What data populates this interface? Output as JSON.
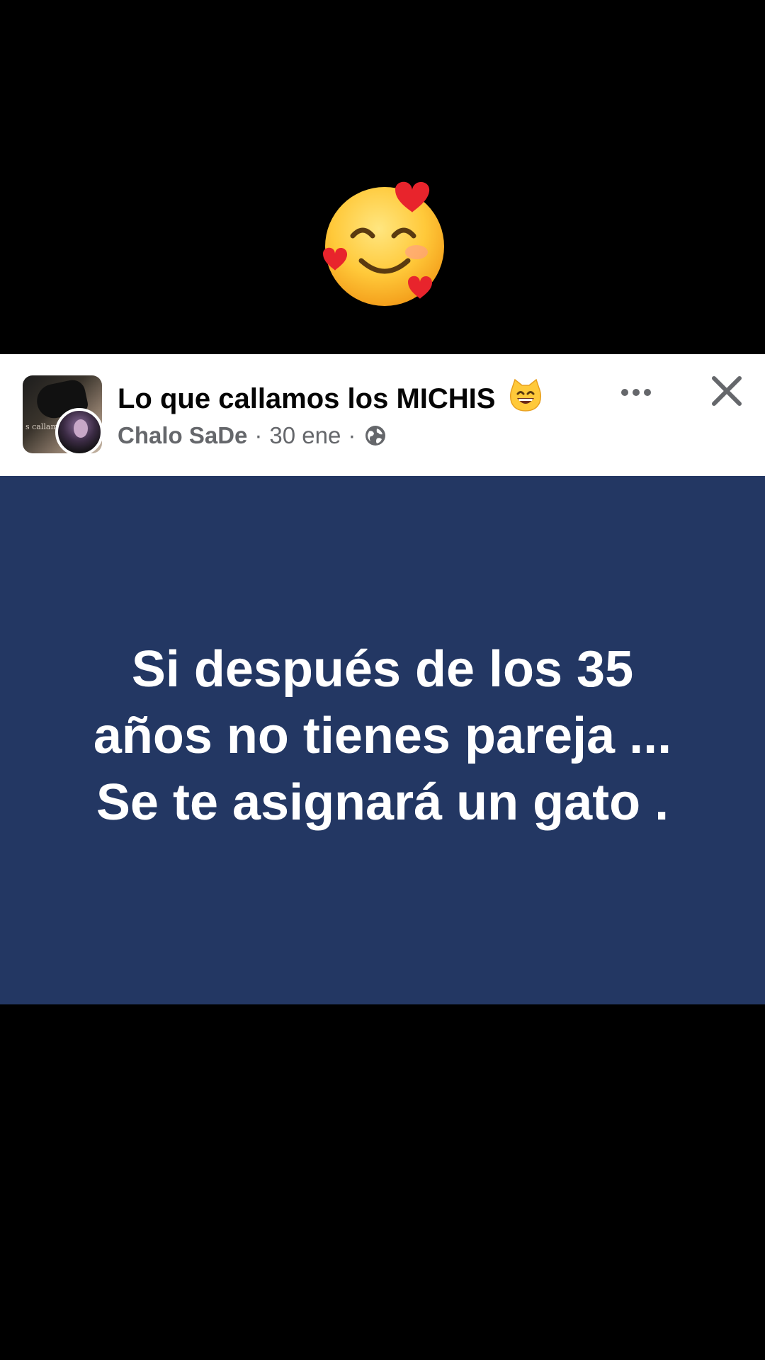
{
  "top_emoji": {
    "icon": "smiling-face-with-hearts-icon"
  },
  "post": {
    "group_name": "Lo que callamos los MICHIS",
    "group_emoji_icon": "grinning-cat-icon",
    "author": "Chalo SaDe",
    "separator": "·",
    "date": "30 ene",
    "privacy_icon": "globe-icon",
    "more_icon": "more-options-icon",
    "close_icon": "close-icon",
    "text_lines": [
      "Si después de los 35",
      "años no tienes pareja ...",
      "Se te asignará un gato ."
    ],
    "background_color": "#233763"
  }
}
